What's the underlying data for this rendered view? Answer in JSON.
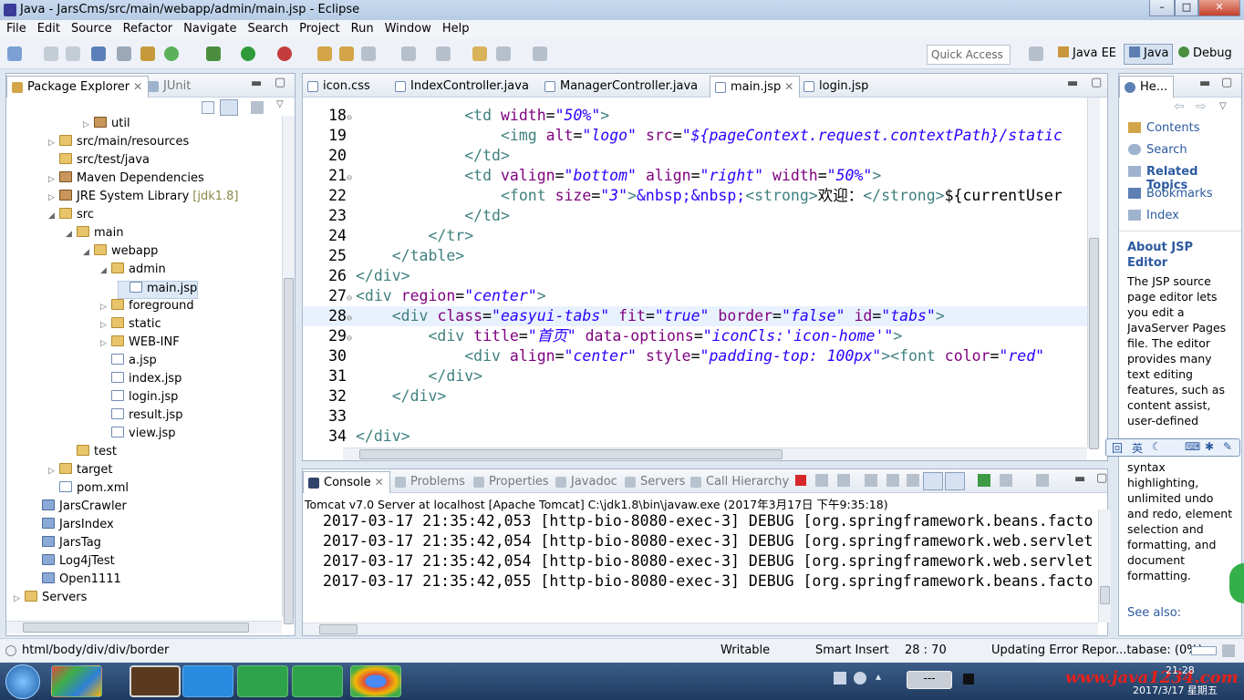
{
  "window": {
    "title": "Java - JarsCms/src/main/webapp/admin/main.jsp - Eclipse"
  },
  "menu": [
    "File",
    "Edit",
    "Source",
    "Refactor",
    "Navigate",
    "Search",
    "Project",
    "Run",
    "Window",
    "Help"
  ],
  "toolbar": {
    "quick_access_placeholder": "Quick Access",
    "perspectives": [
      "Java EE",
      "Java",
      "Debug"
    ]
  },
  "package_explorer": {
    "tabs": [
      "Package Explorer",
      "JUnit"
    ],
    "items": [
      {
        "label": "util",
        "depth": 4,
        "kind": "package",
        "arrow": "▷"
      },
      {
        "label": "src/main/resources",
        "depth": 2,
        "kind": "folder",
        "arrow": "▷"
      },
      {
        "label": "src/test/java",
        "depth": 2,
        "kind": "folder",
        "arrow": ""
      },
      {
        "label": "Maven Dependencies",
        "depth": 2,
        "kind": "lib",
        "arrow": "▷"
      },
      {
        "label": "JRE System Library",
        "extra": "[jdk1.8]",
        "depth": 2,
        "kind": "lib",
        "arrow": "▷"
      },
      {
        "label": "src",
        "depth": 2,
        "kind": "folder",
        "arrow": "◢"
      },
      {
        "label": "main",
        "depth": 3,
        "kind": "folder",
        "arrow": "◢"
      },
      {
        "label": "webapp",
        "depth": 4,
        "kind": "folder",
        "arrow": "◢"
      },
      {
        "label": "admin",
        "depth": 5,
        "kind": "folder",
        "arrow": "◢"
      },
      {
        "label": "main.jsp",
        "depth": 6,
        "kind": "file",
        "arrow": "",
        "selected": true
      },
      {
        "label": "foreground",
        "depth": 5,
        "kind": "folder",
        "arrow": "▷"
      },
      {
        "label": "static",
        "depth": 5,
        "kind": "folder",
        "arrow": "▷"
      },
      {
        "label": "WEB-INF",
        "depth": 5,
        "kind": "folder",
        "arrow": "▷"
      },
      {
        "label": "a.jsp",
        "depth": 5,
        "kind": "file",
        "arrow": ""
      },
      {
        "label": "index.jsp",
        "depth": 5,
        "kind": "file",
        "arrow": ""
      },
      {
        "label": "login.jsp",
        "depth": 5,
        "kind": "file",
        "arrow": ""
      },
      {
        "label": "result.jsp",
        "depth": 5,
        "kind": "file",
        "arrow": ""
      },
      {
        "label": "view.jsp",
        "depth": 5,
        "kind": "file",
        "arrow": ""
      },
      {
        "label": "test",
        "depth": 3,
        "kind": "folder",
        "arrow": ""
      },
      {
        "label": "target",
        "depth": 2,
        "kind": "folder",
        "arrow": "▷"
      },
      {
        "label": "pom.xml",
        "depth": 2,
        "kind": "file",
        "arrow": ""
      },
      {
        "label": "JarsCrawler",
        "depth": 1,
        "kind": "proj",
        "arrow": ""
      },
      {
        "label": "JarsIndex",
        "depth": 1,
        "kind": "proj",
        "arrow": ""
      },
      {
        "label": "JarsTag",
        "depth": 1,
        "kind": "proj",
        "arrow": ""
      },
      {
        "label": "Log4jTest",
        "depth": 1,
        "kind": "proj",
        "arrow": ""
      },
      {
        "label": "Open1111",
        "depth": 1,
        "kind": "proj",
        "arrow": ""
      },
      {
        "label": "Servers",
        "depth": 0,
        "kind": "folder",
        "arrow": "▷"
      }
    ]
  },
  "editor": {
    "tabs": [
      {
        "label": "icon.css",
        "active": false
      },
      {
        "label": "IndexController.java",
        "active": false
      },
      {
        "label": "ManagerController.java",
        "active": false
      },
      {
        "label": "main.jsp",
        "active": true
      },
      {
        "label": "login.jsp",
        "active": false
      }
    ],
    "lines": [
      {
        "n": "18",
        "fold": true,
        "html": "            <span class='tag'>&lt;td</span> <span class='attr'>width</span>=<span class='val'>\"50%\"</span><span class='tag'>&gt;</span>"
      },
      {
        "n": "19",
        "fold": false,
        "html": "                <span class='tag'>&lt;img</span> <span class='attr'>alt</span>=<span class='val'>\"logo\"</span> <span class='attr'>src</span>=<span class='val'>\"${pageContext.request.contextPath}/static</span>"
      },
      {
        "n": "20",
        "fold": false,
        "html": "            <span class='tag'>&lt;/td&gt;</span>"
      },
      {
        "n": "21",
        "fold": true,
        "html": "            <span class='tag'>&lt;td</span> <span class='attr'>valign</span>=<span class='val'>\"bottom\"</span> <span class='attr'>align</span>=<span class='val'>\"right\"</span> <span class='attr'>width</span>=<span class='val'>\"50%\"</span><span class='tag'>&gt;</span>"
      },
      {
        "n": "22",
        "fold": false,
        "html": "                <span class='tag'>&lt;font</span> <span class='attr'>size</span>=<span class='val'>\"3\"</span><span class='tag'>&gt;</span><span class='ent'>&amp;nbsp;&amp;nbsp;</span><span class='tag'>&lt;strong&gt;</span>欢迎：<span class='tag'>&lt;/strong&gt;</span>${currentUser"
      },
      {
        "n": "23",
        "fold": false,
        "html": "            <span class='tag'>&lt;/td&gt;</span>"
      },
      {
        "n": "24",
        "fold": false,
        "html": "        <span class='tag'>&lt;/tr&gt;</span>"
      },
      {
        "n": "25",
        "fold": false,
        "html": "    <span class='tag'>&lt;/table&gt;</span>"
      },
      {
        "n": "26",
        "fold": false,
        "html": "<span class='tag'>&lt;/div&gt;</span>"
      },
      {
        "n": "27",
        "fold": true,
        "html": "<span class='tag'>&lt;div</span> <span class='attr'>region</span>=<span class='val'>\"center\"</span><span class='tag'>&gt;</span>"
      },
      {
        "n": "28",
        "fold": true,
        "current": true,
        "html": "    <span class='tag'>&lt;div</span> <span class='attr'>class</span>=<span class='val'>\"easyui-tabs\"</span> <span class='attr'>fit</span>=<span class='val'>\"true\"</span> <span class='attr'>border</span>=<span class='val'>\"false\"</span> <span class='attr'>id</span>=<span class='val'>\"tabs\"</span><span class='tag'>&gt;</span>"
      },
      {
        "n": "29",
        "fold": true,
        "html": "        <span class='tag'>&lt;div</span> <span class='attr'>title</span>=<span class='val'>\"首页\"</span> <span class='attr'>data-options</span>=<span class='val'>\"iconCls:'icon-home'\"</span><span class='tag'>&gt;</span>"
      },
      {
        "n": "30",
        "fold": false,
        "html": "            <span class='tag'>&lt;div</span> <span class='attr'>align</span>=<span class='val'>\"center\"</span> <span class='attr'>style</span>=<span class='val'>\"padding-top: 100px\"</span><span class='tag'>&gt;&lt;font</span> <span class='attr'>color</span>=<span class='val'>\"red\"</span>"
      },
      {
        "n": "31",
        "fold": false,
        "html": "        <span class='tag'>&lt;/div&gt;</span>"
      },
      {
        "n": "32",
        "fold": false,
        "html": "    <span class='tag'>&lt;/div&gt;</span>"
      },
      {
        "n": "33",
        "fold": false,
        "html": ""
      },
      {
        "n": "34",
        "fold": false,
        "html": "<span class='tag'>&lt;/div&gt;</span>"
      }
    ]
  },
  "console": {
    "tabs": [
      "Console",
      "Problems",
      "Properties",
      "Javadoc",
      "Servers",
      "Call Hierarchy"
    ],
    "header": "Tomcat v7.0 Server at localhost [Apache Tomcat] C:\\jdk1.8\\bin\\javaw.exe (2017年3月17日 下午9:35:18)",
    "lines": [
      "2017-03-17 21:35:42,053 [http-bio-8080-exec-3] DEBUG [org.springframework.beans.facto",
      "2017-03-17 21:35:42,054 [http-bio-8080-exec-3] DEBUG [org.springframework.web.servlet",
      "2017-03-17 21:35:42,054 [http-bio-8080-exec-3] DEBUG [org.springframework.web.servlet",
      "2017-03-17 21:35:42,055 [http-bio-8080-exec-3] DEBUG [org.springframework.beans.facto"
    ]
  },
  "help": {
    "tab": "He...",
    "links": [
      "Contents",
      "Search",
      "Related Topics",
      "Bookmarks",
      "Index"
    ],
    "heading": "About JSP Editor",
    "text_top": "The JSP source page editor lets you edit a JavaServer Pages file. The editor provides many text editing features, such as content assist, user-defined",
    "text_bottom": "syntax highlighting, unlimited undo and redo, element selection and formatting, and document formatting.",
    "see_also": "See also:"
  },
  "status": {
    "path": "html/body/div/div/border",
    "mode": "Writable",
    "insert": "Smart Insert",
    "position": "28 : 70",
    "progress": "Updating Error Repor...tabase: (0%)"
  },
  "taskbar": {
    "watermark": "www.java1234.com",
    "clock_time": "21:28",
    "clock_date": "2017/3/17 星期五"
  },
  "colors": {
    "accent": "#2c5aa0",
    "tag": "#3f7f7f",
    "attr": "#7f007f",
    "value": "#2a00ff"
  }
}
